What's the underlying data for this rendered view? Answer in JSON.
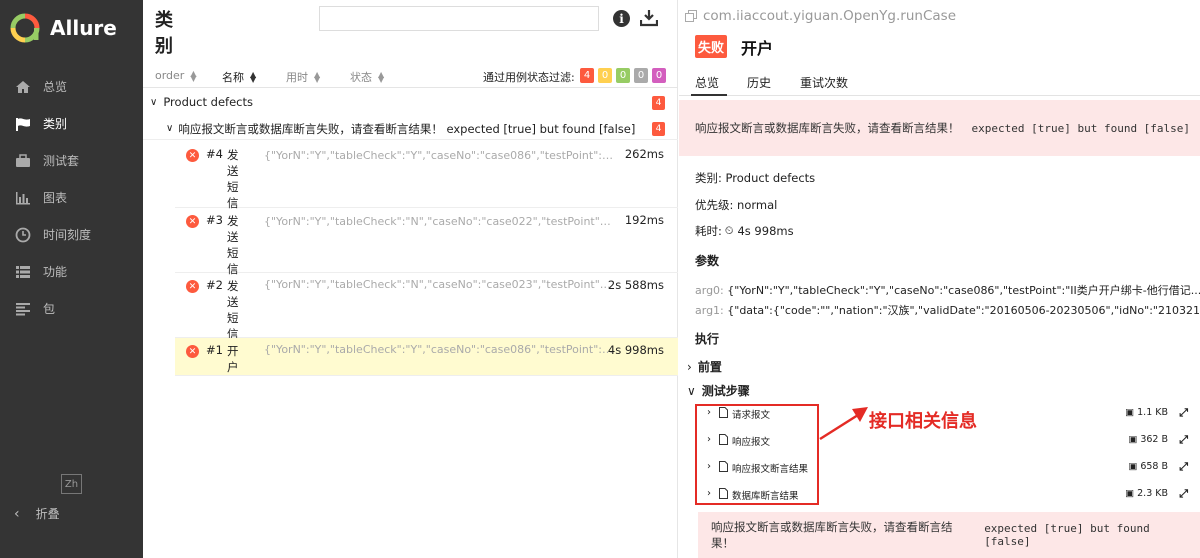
{
  "sidebar": {
    "brand": "Allure",
    "items": [
      {
        "label": "总览",
        "icon": "home-icon"
      },
      {
        "label": "类别",
        "icon": "flag-icon"
      },
      {
        "label": "测试套",
        "icon": "briefcase-icon"
      },
      {
        "label": "图表",
        "icon": "bar-chart-icon"
      },
      {
        "label": "时间刻度",
        "icon": "clock-icon"
      },
      {
        "label": "功能",
        "icon": "list-icon"
      },
      {
        "label": "包",
        "icon": "align-left-icon"
      }
    ],
    "lang": "Zh",
    "collapse_label": "折叠"
  },
  "middle": {
    "title": "类别",
    "search_value": "",
    "sort": {
      "order": "order",
      "name": "名称",
      "duration": "用时",
      "status": "状态"
    },
    "filter_label": "通过用例状态过滤:",
    "filter_badges": [
      {
        "value": "4",
        "color": "#fd5a3e"
      },
      {
        "value": "0",
        "color": "#ffd050"
      },
      {
        "value": "0",
        "color": "#97cc64"
      },
      {
        "value": "0",
        "color": "#aaaaaa"
      },
      {
        "value": "0",
        "color": "#d35ebe"
      }
    ],
    "group": {
      "label": "Product defects",
      "count": "4"
    },
    "subgroup": {
      "label": "响应报文断言或数据库断言失败，请查看断言结果！  expected [true] but found [false]",
      "count": "4"
    },
    "cases": [
      {
        "num": "#4",
        "name": "发送短信",
        "params": "{\"YorN\":\"Y\",\"tableCheck\":\"Y\",\"caseNo\":\"case086\",\"testPoint\":\"II类...",
        "duration": "262ms"
      },
      {
        "num": "#3",
        "name": "发送短信",
        "params": "{\"YorN\":\"Y\",\"tableCheck\":\"N\",\"caseNo\":\"case022\",\"testPoint\":\"II类...",
        "duration": "192ms"
      },
      {
        "num": "#2",
        "name": "发送短信",
        "params": "{\"YorN\":\"Y\",\"tableCheck\":\"N\",\"caseNo\":\"case023\",\"testPoint\":\"III...",
        "duration": "2s 588ms"
      },
      {
        "num": "#1",
        "name": "开户",
        "params": "{\"YorN\":\"Y\",\"tableCheck\":\"Y\",\"caseNo\":\"case086\",\"testPoint\":\"II...",
        "duration": "4s 998ms"
      }
    ]
  },
  "right": {
    "full_name": "com.iiaccout.yiguan.OpenYg.runCase",
    "status": "失败",
    "test_name": "开户",
    "tabs": [
      "总览",
      "历史",
      "重试次数"
    ],
    "error_cn": "响应报文断言或数据库断言失败，请查看断言结果！",
    "error_en": "expected [true] but found [false]",
    "category_line": "类别: Product defects",
    "severity_line": "优先级: normal",
    "duration_label": "耗时:",
    "duration_value": "4s 998ms",
    "params_title": "参数",
    "args": [
      {
        "key": "arg0:",
        "value": "{\"YorN\":\"Y\",\"tableCheck\":\"Y\",\"caseNo\":\"case086\",\"testPoint\":\"II类户开户绑卡-他行借记..."
      },
      {
        "key": "arg1:",
        "value": "{\"data\":{\"code\":\"\",\"nation\":\"汉族\",\"validDate\":\"20160506-20230506\",\"idNo\":\"21032119610..."
      }
    ],
    "execution_title": "执行",
    "setup_label": "前置",
    "steps_label": "测试步骤",
    "attachments": [
      {
        "name": "请求报文",
        "size": "1.1 KB"
      },
      {
        "name": "响应报文",
        "size": "362 B"
      },
      {
        "name": "响应报文断言结果",
        "size": "658 B"
      },
      {
        "name": "数据库断言结果",
        "size": "2.3 KB"
      }
    ],
    "annotation": "接口相关信息",
    "bottom_error_cn": "响应报文断言或数据库断言失败，请查看断言结果！",
    "bottom_error_en": "expected [true] but found [false]"
  }
}
